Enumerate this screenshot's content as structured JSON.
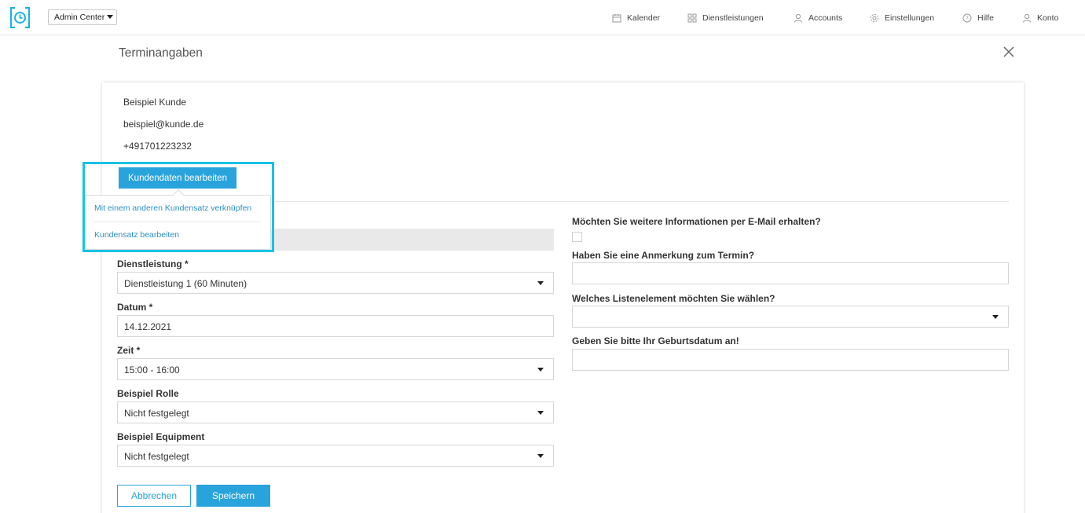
{
  "topbar": {
    "center_select": "Admin Center",
    "nav": {
      "kalender": "Kalender",
      "dienstleistungen": "Dienstleistungen",
      "accounts": "Accounts",
      "einstellungen": "Einstellungen",
      "hilfe": "Hilfe",
      "konto": "Konto"
    }
  },
  "page": {
    "title": "Terminangaben"
  },
  "customer": {
    "name": "Beispiel Kunde",
    "email": "beispiel@kunde.de",
    "phone": "+491701223232",
    "edit_button": "Kundendaten bearbeiten",
    "menu": {
      "link_other": "Mit einem anderen Kundensatz verknüpfen",
      "edit_record": "Kundensatz bearbeiten"
    }
  },
  "form": {
    "service": {
      "label": "Dienstleistung *",
      "value": "Dienstleistung 1 (60 Minuten)"
    },
    "date": {
      "label": "Datum *",
      "value": "14.12.2021"
    },
    "time": {
      "label": "Zeit *",
      "value": "15:00 - 16:00"
    },
    "role": {
      "label": "Beispiel Rolle",
      "value": "Nicht festgelegt"
    },
    "equipment": {
      "label": "Beispiel Equipment",
      "value": "Nicht festgelegt"
    },
    "newsletter": {
      "label": "Möchten Sie weitere Informationen per E-Mail erhalten?"
    },
    "remark": {
      "label": "Haben Sie eine Anmerkung zum Termin?",
      "value": ""
    },
    "list_element": {
      "label": "Welches Listenelement möchten Sie wählen?",
      "value": ""
    },
    "birthday": {
      "label": "Geben Sie bitte Ihr Geburtsdatum an!",
      "value": ""
    }
  },
  "actions": {
    "cancel": "Abbrechen",
    "save": "Speichern"
  },
  "colors": {
    "accent": "#29a3dc",
    "highlight": "#18c2e6",
    "link": "#2d8fc5"
  }
}
